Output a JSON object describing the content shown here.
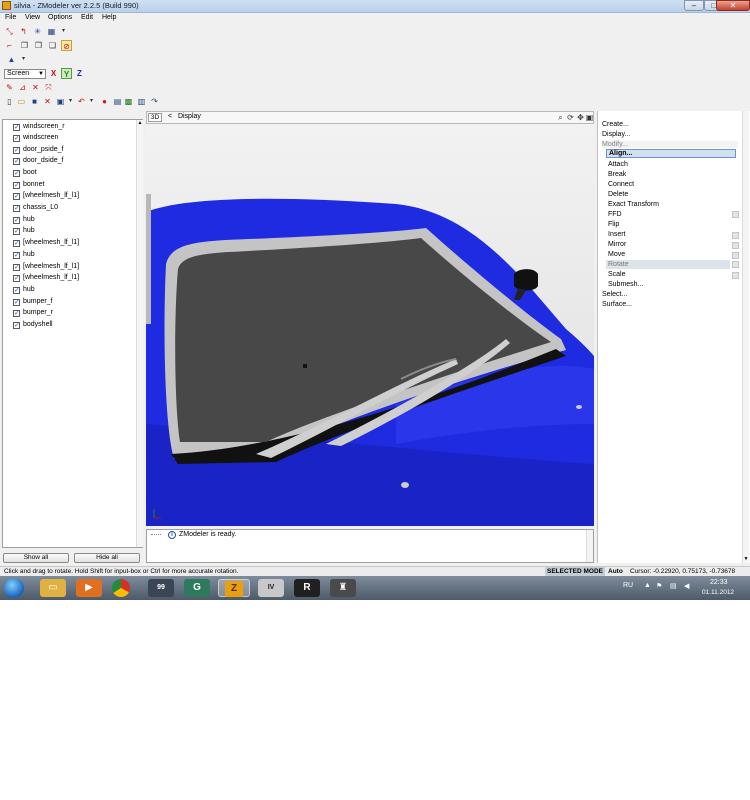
{
  "window": {
    "title": "silvia - ZModeler ver 2.2.5 (Build 990)",
    "minimize_symbol": "–",
    "maximize_symbol": "□",
    "close_symbol": "✕"
  },
  "menu": [
    "File",
    "View",
    "Options",
    "Edit",
    "Help"
  ],
  "toolbar": {
    "view_mode": "Screen",
    "axes": [
      "X",
      "Y",
      "Z"
    ]
  },
  "objects": [
    "windscreen_r",
    "windscreen",
    "door_pside_f",
    "door_dside_f",
    "boot",
    "bonnet",
    "[wheelmesh_lf_l1]",
    "chassis_L0",
    "hub",
    "hub",
    "[wheelmesh_lf_l1]",
    "hub",
    "[wheelmesh_lf_l1]",
    "[wheelmesh_lf_l1]",
    "hub",
    "bumper_f",
    "bumper_r",
    "bodyshell"
  ],
  "object_panel": {
    "show_all": "Show all",
    "hide_all": "Hide all"
  },
  "viewport": {
    "view_label": "3D",
    "back_arrow": "<",
    "display_label": "Display",
    "axis_indicator": "Z",
    "colors": {
      "car_body": "#1f2be0",
      "glass": "#484848",
      "trim": "#c4c4c4",
      "background": "#e9e9e9"
    }
  },
  "log": {
    "message": "ZModeler is ready.",
    "info_icon_glyph": "i"
  },
  "commands": {
    "create": "Create...",
    "display": "Display...",
    "modify": "Modify...",
    "modify_items": [
      "Align...",
      "Attach",
      "Break",
      "Connect",
      "Delete",
      "Exact Transform",
      "FFD",
      "Flip",
      "Insert",
      "Mirror",
      "Move",
      "Rotate",
      "Scale",
      "Submesh..."
    ],
    "selected_item": "Align...",
    "active_item": "Rotate",
    "select": "Select...",
    "surface": "Surface..."
  },
  "status": {
    "hint": "Click and drag to rotate. Hold Shift for input-box or Ctrl for more accurate rotation.",
    "mode": "SELECTED MODE",
    "auto": "Auto",
    "cursor": "Cursor: -0.22920, 0.75173, -0.73678"
  },
  "taskbar": {
    "lang": "RU",
    "time": "22:33",
    "date": "01.11.2012",
    "app_badge": "99",
    "apps": [
      "windows-start",
      "file-explorer",
      "media-player",
      "chrome",
      "monitor-app",
      "gta-app",
      "zmodeler",
      "gta-iv",
      "rockstar",
      "game-app"
    ]
  }
}
